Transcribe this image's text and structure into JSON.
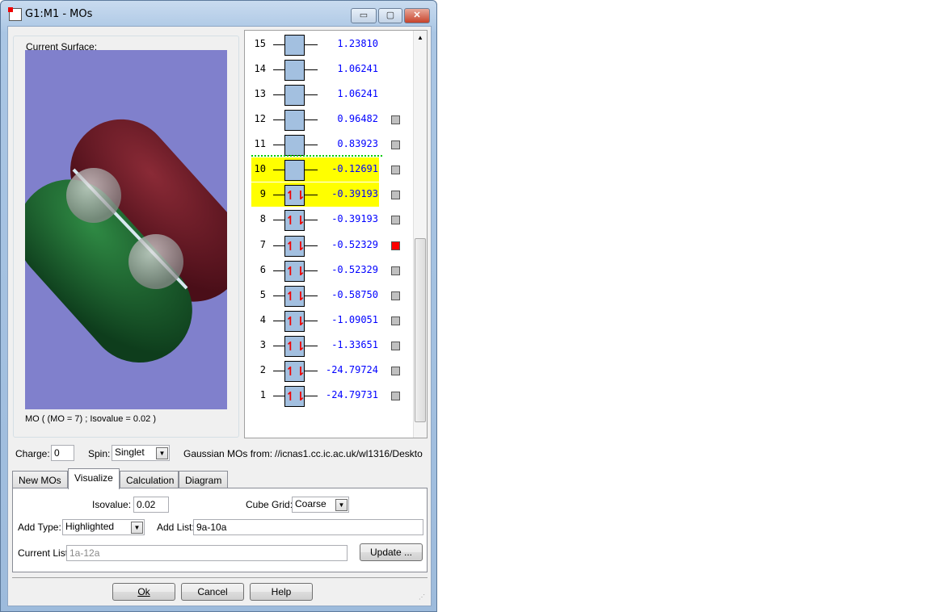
{
  "window": {
    "title": "G1:M1 - MOs",
    "minimize": "▭",
    "maximize": "▢",
    "close": "✕"
  },
  "surface": {
    "group_label": "Current Surface:",
    "caption": "MO ( (MO = 7) ; Isovalue = 0.02 )"
  },
  "orbitals": [
    {
      "n": "15",
      "energy": "1.23810",
      "occupied": false,
      "highlighted": false,
      "checkbox": null
    },
    {
      "n": "14",
      "energy": "1.06241",
      "occupied": false,
      "highlighted": false,
      "checkbox": null
    },
    {
      "n": "13",
      "energy": "1.06241",
      "occupied": false,
      "highlighted": false,
      "checkbox": null
    },
    {
      "n": "12",
      "energy": "0.96482",
      "occupied": false,
      "highlighted": false,
      "checkbox": "gray"
    },
    {
      "n": "11",
      "energy": "0.83923",
      "occupied": false,
      "highlighted": false,
      "checkbox": "gray"
    },
    {
      "n": "10",
      "energy": "-0.12691",
      "occupied": false,
      "highlighted": true,
      "checkbox": "gray"
    },
    {
      "n": "9",
      "energy": "-0.39193",
      "occupied": true,
      "highlighted": true,
      "checkbox": "gray"
    },
    {
      "n": "8",
      "energy": "-0.39193",
      "occupied": true,
      "highlighted": false,
      "checkbox": "gray"
    },
    {
      "n": "7",
      "energy": "-0.52329",
      "occupied": true,
      "highlighted": false,
      "checkbox": "red"
    },
    {
      "n": "6",
      "energy": "-0.52329",
      "occupied": true,
      "highlighted": false,
      "checkbox": "gray"
    },
    {
      "n": "5",
      "energy": "-0.58750",
      "occupied": true,
      "highlighted": false,
      "checkbox": "gray"
    },
    {
      "n": "4",
      "energy": "-1.09051",
      "occupied": true,
      "highlighted": false,
      "checkbox": "gray"
    },
    {
      "n": "3",
      "energy": "-1.33651",
      "occupied": true,
      "highlighted": false,
      "checkbox": "gray"
    },
    {
      "n": "2",
      "energy": "-24.79724",
      "occupied": true,
      "highlighted": false,
      "checkbox": "gray"
    },
    {
      "n": "1",
      "energy": "-24.79731",
      "occupied": true,
      "highlighted": false,
      "checkbox": "gray"
    }
  ],
  "electron_glyph": "↿⇂",
  "colors": {
    "highlight": "#ffff00",
    "energy": "#0000ff",
    "selected": "#ff0000",
    "homo_lumo_line": "#00cc00"
  },
  "controls": {
    "charge_label": "Charge:",
    "charge": "0",
    "spin_label": "Spin:",
    "spin": "Singlet",
    "source_label": "Gaussian MOs from:",
    "source": "//icnas1.cc.ic.ac.uk/wl1316/Deskto"
  },
  "tabs": [
    "New MOs",
    "Visualize",
    "Calculation",
    "Diagram"
  ],
  "visualize": {
    "isovalue_label": "Isovalue:",
    "isovalue": "0.02",
    "cube_grid_label": "Cube Grid:",
    "cube_grid": "Coarse",
    "add_type_label": "Add Type:",
    "add_type": "Highlighted",
    "add_list_label": "Add List:",
    "add_list": "9a-10a",
    "current_list_label": "Current List:",
    "current_list": "1a-12a",
    "update": "Update ..."
  },
  "buttons": {
    "ok": "Ok",
    "cancel": "Cancel",
    "help": "Help"
  }
}
